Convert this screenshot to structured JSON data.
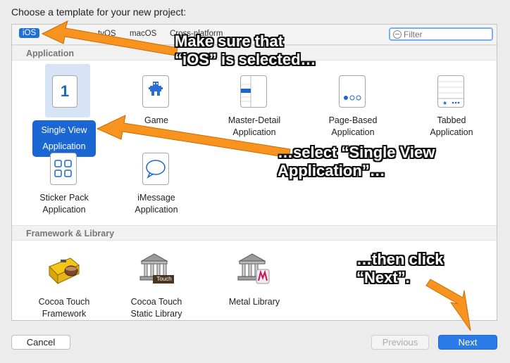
{
  "prompt": "Choose a template for your new project:",
  "tabs": [
    "iOS",
    "tvOS",
    "macOS",
    "Cross-platform"
  ],
  "selected_tab": "iOS",
  "filter": {
    "placeholder": "Filter"
  },
  "sections": {
    "application": "Application",
    "framework": "Framework & Library"
  },
  "templates": {
    "single_view": [
      "Single View",
      "Application"
    ],
    "single_view_icon_text": "1",
    "game": "Game",
    "master_detail": [
      "Master-Detail",
      "Application"
    ],
    "page_based": [
      "Page-Based",
      "Application"
    ],
    "tabbed": [
      "Tabbed",
      "Application"
    ],
    "sticker_pack": [
      "Sticker Pack",
      "Application"
    ],
    "imessage": [
      "iMessage",
      "Application"
    ],
    "cocoa_touch_framework": [
      "Cocoa Touch",
      "Framework"
    ],
    "cocoa_touch_static": [
      "Cocoa Touch",
      "Static Library"
    ],
    "static_badge": "Touch",
    "metal_library": "Metal Library"
  },
  "buttons": {
    "cancel": "Cancel",
    "previous": "Previous",
    "next": "Next"
  },
  "annotations": {
    "ios": [
      "Make sure that",
      "“iOS” is selected…"
    ],
    "single_view": [
      "…select “Single View",
      "Application”…"
    ],
    "next": [
      "…then click",
      "“Next”."
    ]
  },
  "colors": {
    "accent": "#1a66d2",
    "arrow": "#f7931e",
    "annotation_text": "#ffffff"
  }
}
